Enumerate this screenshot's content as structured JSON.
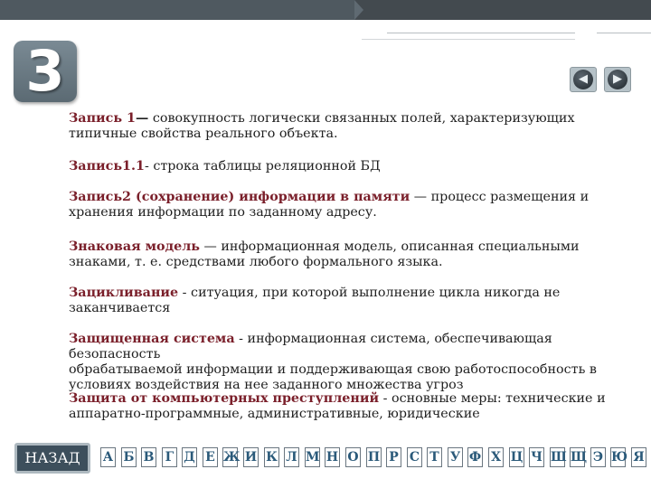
{
  "slide": {
    "number": "3",
    "back_label": "НАЗАД",
    "nav": {
      "prev_icon": "arrow-left-icon",
      "next_icon": "arrow-right-icon"
    }
  },
  "entries": [
    {
      "term": "Запись 1",
      "sep": "—",
      "text": " совокупность логически связанных полей, характеризующих",
      "text2": "типичные свойства реального объекта."
    },
    {
      "term": "Запись1.1",
      "sep": "-",
      "text": "  строка таблицы реляционной БД",
      "text2": ""
    },
    {
      "term": "Запись2 (сохранение) информации в памяти",
      "sep": " —",
      "text": " процесс размещения и",
      "text2": "хранения информации по заданному адресу."
    },
    {
      "term": "Знаковая модель",
      "sep": " —",
      "text": " информационная модель, описанная специальными",
      "text2": "знаками, т. е. средствами любого формального языка."
    },
    {
      "term": "Зацикливание",
      "sep": " -",
      "text": " ситуация, при которой выполнение цикла никогда не",
      "text2": "заканчивается"
    },
    {
      "term": "Защищенная система",
      "sep": " -",
      "text": " информационная система, обеспечивающая безопасность",
      "text2": "обрабатываемой информации и поддерживающая свою работоспособность в",
      "text3": "условиях воздействия на нее заданного множества угроз"
    },
    {
      "term": "Защита от компьютерных преступлений",
      "sep": " -",
      "text": " основные меры: технические и",
      "text2": "аппаратно-программные, административные, юридические"
    }
  ],
  "alphabet": [
    "А",
    "Б",
    "В",
    "Г",
    "Д",
    "Е",
    "Ж",
    "И",
    "К",
    "Л",
    "М",
    "Н",
    "О",
    "П",
    "Р",
    "С",
    "Т",
    "У",
    "Ф",
    "Х",
    "Ц",
    "Ч",
    "Ш",
    "Щ",
    "Э",
    "Ю",
    "Я"
  ],
  "colors": {
    "term": "#7a1f2a",
    "letters": "#2b5a7a",
    "back_button": "#3d4f5c"
  }
}
